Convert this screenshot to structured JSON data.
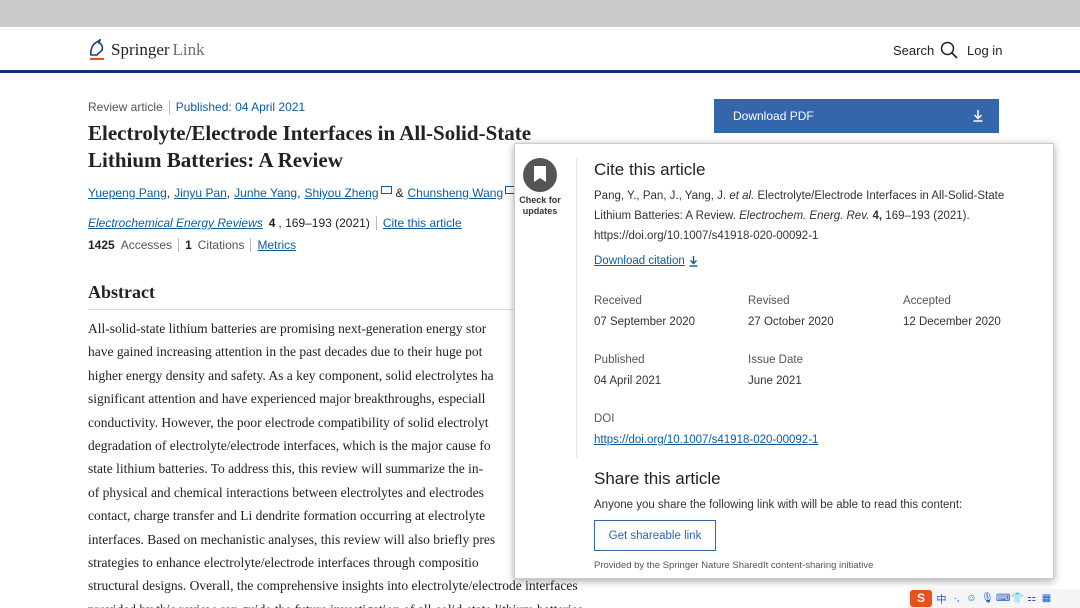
{
  "header": {
    "logo_name": "Springer",
    "logo_suffix": "Link",
    "search_label": "Search",
    "login_label": "Log in"
  },
  "article": {
    "type": "Review article",
    "published": "Published: 04 April 2021",
    "title": "Electrolyte/Electrode Interfaces in All-Solid-State Lithium Batteries: A Review",
    "authors": [
      "Yuepeng Pang",
      "Jinyu Pan",
      "Junhe Yang",
      "Shiyou Zheng",
      "Chunsheng Wang"
    ],
    "author_and": "&",
    "journal": "Electrochemical Energy Reviews",
    "volume": "4",
    "pages": ", 169–193 (2021)",
    "cite_link": "Cite this article",
    "accesses_count": "1425",
    "accesses_label": "Accesses",
    "citations_count": "1",
    "citations_label": "Citations",
    "metrics_link": "Metrics"
  },
  "abstract": {
    "heading": "Abstract",
    "lines": [
      "All-solid-state lithium batteries are promising next-generation energy stor",
      "have gained increasing attention in the past decades due to their huge pot",
      "higher energy density and safety. As a key component, solid electrolytes ha",
      "significant attention and have experienced major breakthroughs, especiall",
      "conductivity. However, the poor electrode compatibility of solid electrolyt",
      "degradation of electrolyte/electrode interfaces, which is the major cause fo",
      "state lithium batteries. To address this, this review will summarize the in-",
      "of physical and chemical interactions between electrolytes and electrodes",
      "contact, charge transfer and Li dendrite formation occurring at electrolyte",
      "interfaces. Based on mechanistic analyses, this review will also briefly pres",
      "strategies to enhance electrolyte/electrode interfaces through compositio",
      "structural designs. Overall, the comprehensive insights into electrolyte/electrode interfaces",
      "provided by this review can guide the future investigation of all-solid-state lithium batteries"
    ]
  },
  "sidebar": {
    "download_pdf": "Download PDF",
    "download_icon": "download-arrow-icon"
  },
  "cite_popup": {
    "check_updates_line1": "Check for",
    "check_updates_line2": "updates",
    "heading": "Cite this article",
    "citation_authors": "Pang, Y., Pan, J., Yang, J.",
    "citation_etal": "et al.",
    "citation_title": "Electrolyte/Electrode Interfaces in All-Solid-State Lithium Batteries: A Review.",
    "citation_journal": "Electrochem. Energ. Rev.",
    "citation_volume": "4,",
    "citation_pages": "169–193 (2021).",
    "citation_doi": "https://doi.org/10.1007/s41918-020-00092-1",
    "download_citation": "Download citation",
    "dates": {
      "received_label": "Received",
      "received_value": "07 September 2020",
      "revised_label": "Revised",
      "revised_value": "27 October 2020",
      "accepted_label": "Accepted",
      "accepted_value": "12 December 2020",
      "published_label": "Published",
      "published_value": "04 April 2021",
      "issue_label": "Issue Date",
      "issue_value": "June 2021"
    },
    "doi_label": "DOI",
    "doi_value": "https://doi.org/10.1007/s41918-020-00092-1",
    "share_heading": "Share this article",
    "share_text": "Anyone you share the following link with will be able to read this content:",
    "share_button": "Get shareable link",
    "provided_by": "Provided by the Springer Nature SharedIt content-sharing initiative"
  },
  "tray": {
    "ime_logo": "S",
    "ime_mode": "中",
    "items": [
      "·,",
      "☺",
      "🎙",
      "⌨",
      "👕",
      "⚏",
      "▦"
    ]
  },
  "colors": {
    "header_rule": "#10316b",
    "link": "#0c5c9c",
    "button": "#3366aa"
  }
}
